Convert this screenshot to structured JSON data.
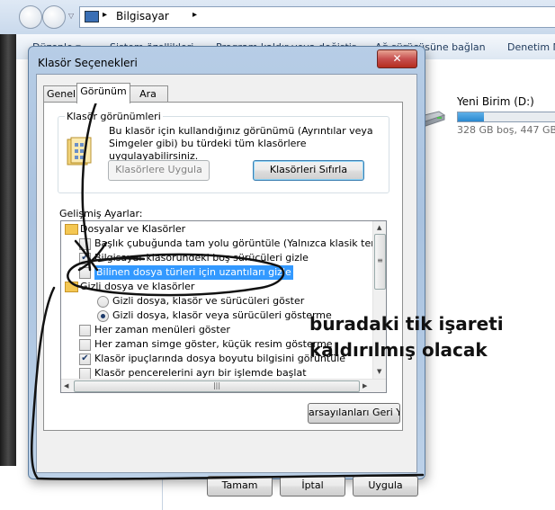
{
  "address_bar": {
    "location": "Bilgisayar",
    "separator": "▸"
  },
  "command_bar": {
    "organize": "Düzenle ▾",
    "system_properties": "Sistem özellikleri",
    "uninstall": "Program kaldır veya değiştir",
    "map_drive": "Ağ sürücüsüne bağlan",
    "control_panel": "Denetim M"
  },
  "drive": {
    "name": "Yeni Birim (D:)",
    "free_text": "328 GB boş, 447 GB to",
    "used_fraction": 0.27
  },
  "dialog": {
    "title": "Klasör Seçenekleri",
    "close": "✕",
    "tabs": [
      {
        "label": "Genel"
      },
      {
        "label": "Görünüm"
      },
      {
        "label": "Ara"
      }
    ],
    "folder_views": {
      "title": "Klasör görünümleri",
      "description": "Bu klasör için kullandığınız görünümü (Ayrıntılar veya Simgeler gibi) bu türdeki tüm klasörlere uygulayabilirsiniz.",
      "apply_button": "Klasörlere Uygula",
      "reset_button": "Klasörleri Sıfırla"
    },
    "advanced_label": "Gelişmiş Ayarlar:",
    "tree": [
      {
        "type": "folder",
        "label": "Dosyalar ve Klasörler"
      },
      {
        "type": "check",
        "checked": false,
        "label": "Başlık çubuğunda tam yolu görüntüle (Yalnızca klasik tema)"
      },
      {
        "type": "check",
        "checked": true,
        "label": "Bilgisayar klasöründeki boş sürücüleri gizle"
      },
      {
        "type": "check",
        "checked": false,
        "label": "Bilinen dosya türleri için uzantıları gizle",
        "selected": true
      },
      {
        "type": "folder",
        "label": "Gizli dosya ve klasörler"
      },
      {
        "type": "radio",
        "checked": false,
        "label": "Gizli dosya, klasör ve sürücüleri göster"
      },
      {
        "type": "radio",
        "checked": true,
        "label": "Gizli dosya, klasör veya sürücüleri gösterme"
      },
      {
        "type": "check",
        "checked": false,
        "label": "Her zaman menüleri göster"
      },
      {
        "type": "check",
        "checked": false,
        "label": "Her zaman simge göster, küçük resim gösterme"
      },
      {
        "type": "check",
        "checked": true,
        "label": "Klasör ipuçlarında dosya boyutu bilgisini görüntüle"
      },
      {
        "type": "check",
        "checked": false,
        "label": "Klasör pencerelerini ayrı bir işlemde başlat"
      }
    ],
    "restore_button": "arsayılanları Geri Yükl",
    "ok_button": "Tamam",
    "cancel_button": "İptal",
    "apply_button": "Uygula"
  },
  "annotation": {
    "line1": "buradaki tik işareti",
    "line2": "kaldırılmış olacak",
    "ink_color": "#111111"
  }
}
